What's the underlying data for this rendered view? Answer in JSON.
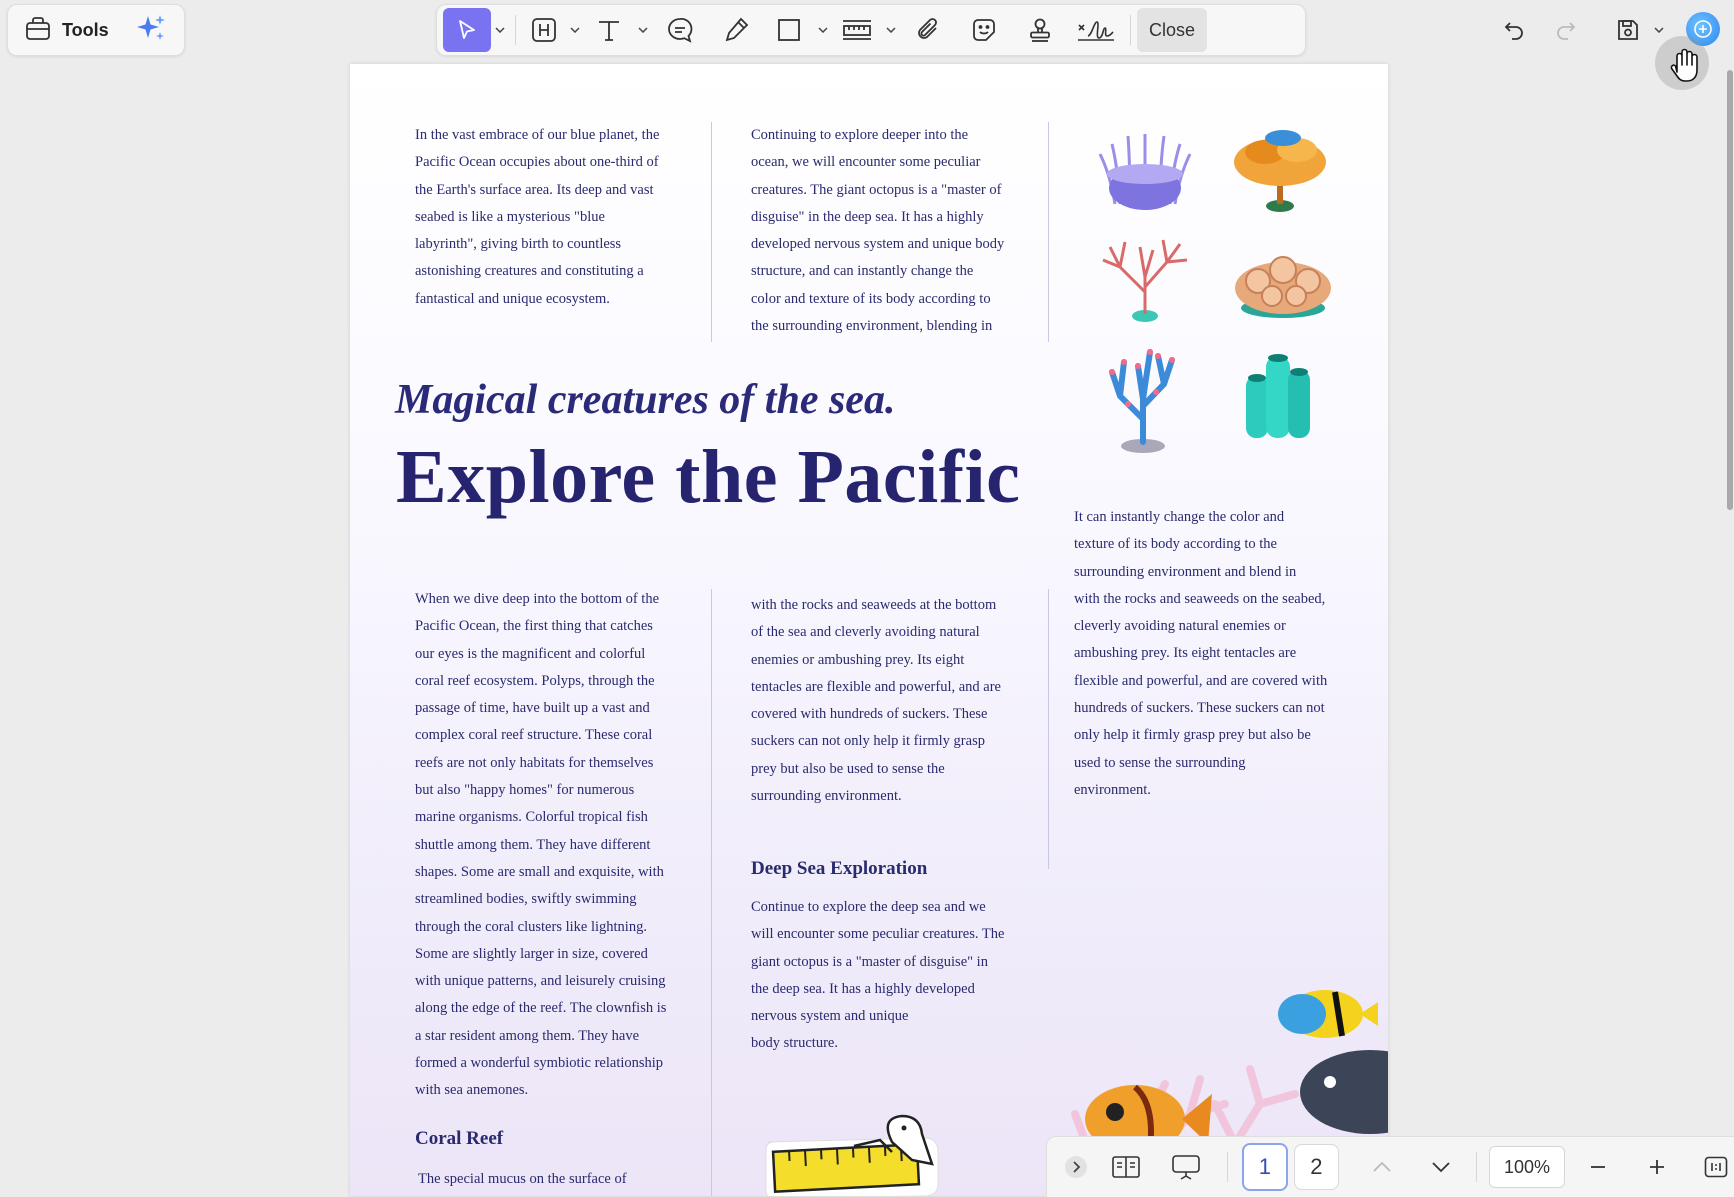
{
  "toolbar": {
    "tools_label": "Tools",
    "close_label": "Close"
  },
  "document": {
    "subtitle": "Magical creatures of the sea.",
    "title": "Explore the Pacific",
    "top_col1": [
      "In the vast embrace of our blue planet, the",
      "Pacific Ocean occupies about one-third of",
      "the Earth's surface area. Its deep and vast",
      "seabed is like a mysterious \"blue",
      "labyrinth\", giving birth to countless",
      "astonishing creatures and constituting a",
      "fantastical and unique ecosystem."
    ],
    "top_col2": [
      "Continuing to explore deeper into the",
      "ocean, we will encounter some peculiar",
      "creatures. The giant octopus is a \"master of",
      "disguise\" in the deep sea. It has a highly",
      "developed nervous system and unique body",
      "structure, and can instantly change the",
      "color and texture of its body according to",
      "the surrounding environment, blending in"
    ],
    "right_col": [
      "It can instantly change the color and",
      "texture of its body according to the",
      "surrounding environment and blend in",
      "with the rocks and seaweeds on the seabed,",
      "cleverly avoiding natural enemies or",
      "ambushing prey. Its eight tentacles are",
      "flexible and powerful, and are covered with",
      "hundreds of suckers. These suckers can not",
      "only help it firmly grasp prey but also be",
      "used to sense the surrounding",
      "environment."
    ],
    "bottom_col1": [
      "When we dive deep into the bottom of the",
      "Pacific Ocean, the first thing that catches",
      "our eyes is the magnificent and colorful",
      "coral reef ecosystem. Polyps, through the",
      "passage of time, have built up a vast and",
      "complex coral reef structure. These coral",
      "reefs are not only habitats for themselves",
      "but also \"happy homes\" for numerous",
      "marine organisms. Colorful tropical fish",
      "shuttle among them. They have different",
      "shapes. Some are small and exquisite, with",
      "streamlined bodies, swiftly swimming",
      "through the coral clusters like lightning.",
      "Some are slightly larger in size, covered",
      "with unique patterns, and leisurely cruising",
      "along the edge of the reef. The clownfish is",
      "a star resident among them. They have",
      "formed a wonderful symbiotic relationship",
      "with sea anemones."
    ],
    "bottom_col2": [
      "with the rocks and seaweeds at the bottom",
      "of the sea and cleverly avoiding natural",
      "enemies or ambushing prey. Its eight",
      "tentacles are flexible and powerful, and are",
      "covered with hundreds of suckers. These",
      "suckers can not only help it firmly grasp",
      "prey but also be used to sense the",
      "surrounding environment."
    ],
    "deep_sea_heading": "Deep Sea Exploration",
    "deep_sea_text": [
      "Continue to explore the deep sea and we",
      "will encounter some peculiar creatures. The",
      "giant octopus is a \"master of disguise\" in",
      "the deep sea. It has a highly developed",
      "nervous system and unique",
      "body structure."
    ],
    "coral_reef_heading": "Coral Reef",
    "coral_reef_text": "The special mucus on the surface of"
  },
  "bottom_nav": {
    "page_1": "1",
    "page_2": "2",
    "zoom": "100%"
  },
  "colors": {
    "accent": "#7a73f1",
    "heading": "#26246f",
    "body_text": "#2a2a6e"
  }
}
